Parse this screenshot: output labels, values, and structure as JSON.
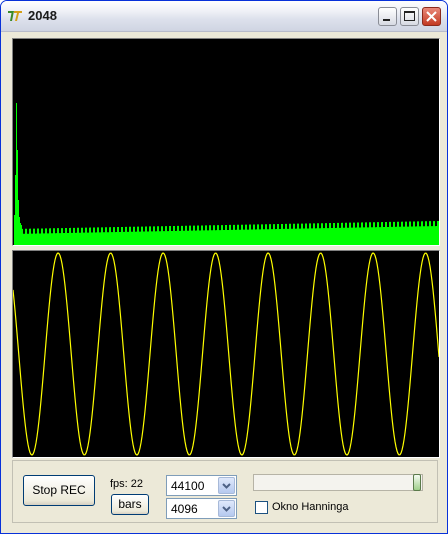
{
  "window": {
    "title": "2048",
    "icon": "app-logo-icon",
    "controls": [
      "minimize-icon",
      "maximize-icon",
      "close-icon"
    ]
  },
  "spectrum": {
    "bar_color": "#00ff00",
    "background": "#000000"
  },
  "waveform": {
    "line_color": "#ffff00",
    "background": "#000000",
    "cycles_visible": 8
  },
  "controls": {
    "rec_button_label": "Stop REC",
    "fps_label": "fps: 22",
    "bars_button_label": "bars",
    "sample_rate_value": "44100",
    "fft_size_value": "4096",
    "checkbox_label": "Okno Hanninga",
    "checkbox_checked": false,
    "slider_value": 1.0
  }
}
